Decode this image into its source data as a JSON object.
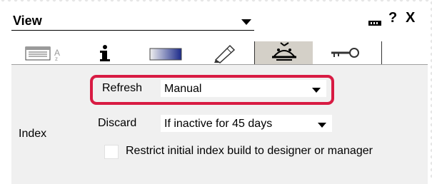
{
  "header": {
    "title": "View",
    "pin_icon": "pin-icon",
    "help_glyph": "?",
    "close_glyph": "X"
  },
  "tabs": [
    {
      "icon": "properties-icon"
    },
    {
      "icon": "info-icon"
    },
    {
      "icon": "gradient-icon"
    },
    {
      "icon": "pen-icon"
    },
    {
      "icon": "beanie-icon",
      "active": true
    },
    {
      "icon": "key-icon"
    }
  ],
  "index_section": {
    "label": "Index",
    "refresh": {
      "label": "Refresh",
      "value": "Manual"
    },
    "discard": {
      "label": "Discard",
      "value": "If inactive for 45 days"
    },
    "restrict_checkbox": {
      "label": "Restrict initial index build to designer or manager",
      "checked": false
    }
  },
  "colors": {
    "highlight": "#d81b43",
    "content_bg": "#f0f0f0",
    "active_tab_bg": "#d4d0c8"
  }
}
